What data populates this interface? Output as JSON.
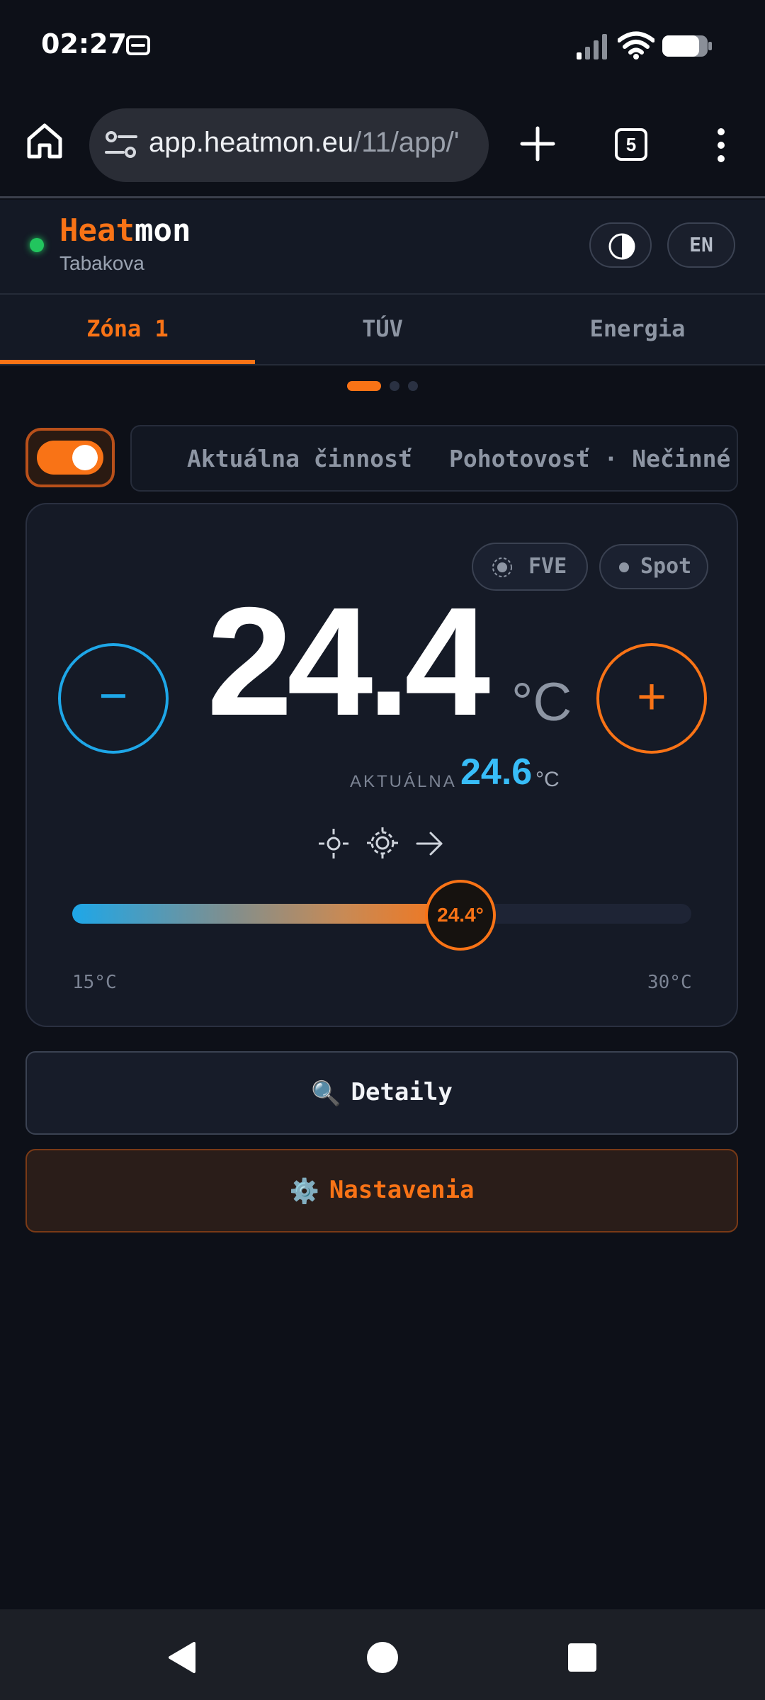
{
  "status_bar": {
    "time": "02:27",
    "notification_icon": "wallet-icon",
    "signal_icon": "cell-signal-icon",
    "wifi_icon": "wifi-icon",
    "battery_icon": "battery-icon"
  },
  "browser": {
    "home_icon": "home-icon",
    "url_host": "app.heatmon.eu",
    "url_path": "/11/app/'",
    "new_tab_icon": "plus-icon",
    "tab_count": "5",
    "menu_icon": "kebab-menu-icon"
  },
  "header": {
    "online_color": "#22c55e",
    "brand_part1": "Heat",
    "brand_part2": "mon",
    "site": "Tabakova",
    "theme_icon": "contrast-icon",
    "lang": "EN"
  },
  "tabs": [
    {
      "label": "Zóna 1",
      "active": true
    },
    {
      "label": "TÚV",
      "active": false
    },
    {
      "label": "Energia",
      "active": false
    }
  ],
  "pager": {
    "count": 3,
    "active": 0
  },
  "zone": {
    "power_on": true,
    "activity_label": "Aktuálna činnosť",
    "activity_status": "Pohotovosť · Nečinné",
    "chip_fve": "FVE",
    "chip_spot": "Spot",
    "minus_label": "−",
    "plus_label": "+",
    "setpoint": "24.4",
    "setpoint_unit": "°C",
    "current_label": "AKTUÁLNA",
    "current_value": "24.6",
    "current_unit": "°C",
    "mode_icons": [
      "sun-icon",
      "gear-icon",
      "arrow-right-icon"
    ],
    "slider": {
      "min": 15,
      "max": 30,
      "value": 24.4,
      "thumb_label": "24.4°",
      "min_label": "15°C",
      "max_label": "30°C"
    }
  },
  "actions": {
    "details_icon": "🔍",
    "details_label": "Detaily",
    "settings_icon": "⚙️",
    "settings_label": "Nastavenia"
  },
  "colors": {
    "accent": "#f97316",
    "cool": "#1ea7e8",
    "current": "#38bdf8",
    "background": "#0d1018"
  }
}
